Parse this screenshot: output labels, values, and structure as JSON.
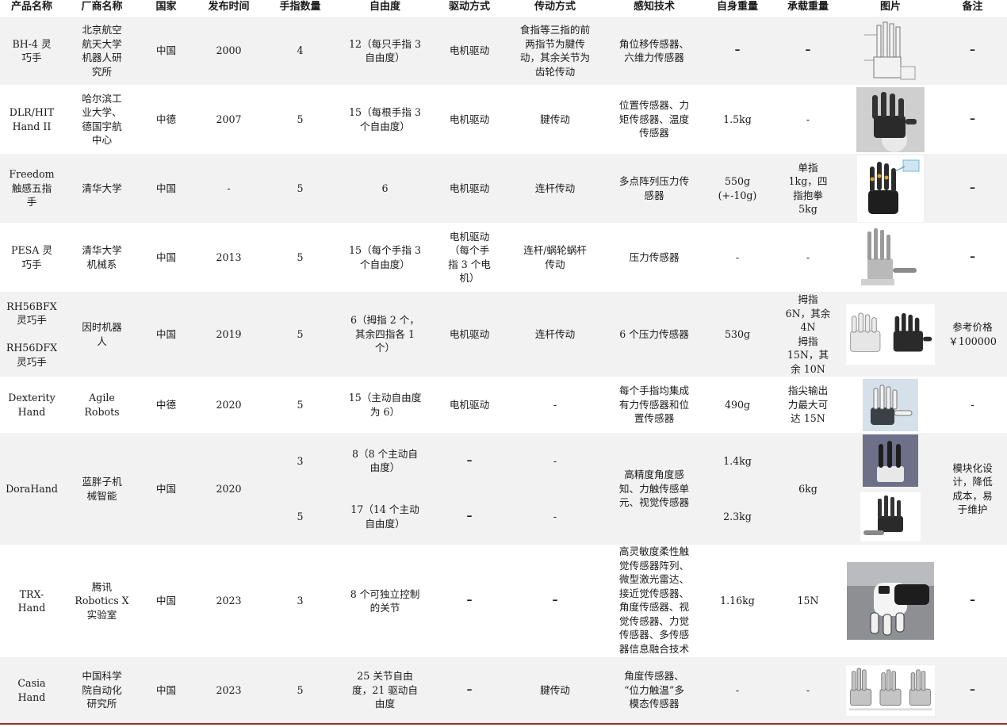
{
  "headers": [
    "产品名称",
    "厂商名称",
    "国家",
    "发布时间",
    "手指数量",
    "自由度",
    "驱动方式",
    "传动方式",
    "感知技术",
    "自身重量",
    "承载重量",
    "图片",
    "备注"
  ],
  "rows": [
    {
      "product": "BH-4 灵\n巧手",
      "maker": "北京航空\n航天大学\n机器人研\n究所",
      "country": "中国",
      "year": "2000",
      "fingers": "4",
      "dof": "12（每只手指 3\n自由度）",
      "drive": "电机驱动",
      "trans": "食指等三指的前\n两指节为腱传\n动，其余关节为\n齿轮传动",
      "sense": "角位移传感器、\n六维力传感器",
      "weight": "–",
      "load": "–",
      "image": "drawing-icon",
      "note": "–"
    },
    {
      "product": "DLR/HIT\nHand II",
      "maker": "哈尔滨工\n业大学、\n德国宇航\n中心",
      "country": "中德",
      "year": "2007",
      "fingers": "5",
      "dof": "15（每根手指 3\n个自由度）",
      "drive": "电机驱动",
      "trans": "腱传动",
      "sense": "位置传感器、力\n矩传感器、温度\n传感器",
      "weight": "1.5kg",
      "load": "-",
      "image": "robot-hand-photo-icon",
      "note": "–"
    },
    {
      "product": "Freedom\n触感五指\n手",
      "maker": "清华大学",
      "country": "中国",
      "year": "-",
      "fingers": "5",
      "dof": "6",
      "drive": "电机驱动",
      "trans": "连杆传动",
      "sense": "多点阵列压力传\n感器",
      "weight": "550g\n(+-10g)",
      "load": "单指\n1kg，四\n指抱拳\n5kg",
      "image": "robot-hand-photo-icon",
      "note": "–"
    },
    {
      "product": "PESA 灵\n巧手",
      "maker": "清华大学\n机械系",
      "country": "中国",
      "year": "2013",
      "fingers": "5",
      "dof": "15（每个手指 3\n个自由度）",
      "drive": "电机驱动\n（每个手\n指 3 个电\n机）",
      "trans": "连杆/蜗轮蜗杆\n传动",
      "sense": "压力传感器",
      "weight": "-",
      "load": "-",
      "image": "robot-hand-photo-icon",
      "note": "–"
    },
    {
      "product": "RH56BFX\n灵巧手\n\nRH56DFX\n灵巧手",
      "maker": "因时机器\n人",
      "country": "中国",
      "year": "2019",
      "fingers": "5",
      "dof": "6（拇指 2 个，\n其余四指各 1\n个）",
      "drive": "电机驱动",
      "trans": "连杆传动",
      "sense": "6 个压力传感器",
      "weight": "530g",
      "load": "拇指\n6N，其余\n4N\n拇指\n15N，其\n余 10N",
      "image": "robot-hand-pair-photo-icon",
      "note": "参考价格\n￥100000"
    },
    {
      "product": "Dexterity\nHand",
      "maker": "Agile\nRobots",
      "country": "中德",
      "year": "2020",
      "fingers": "5",
      "dof": "15（主动自由度\n为 6）",
      "drive": "电机驱动",
      "trans": "-",
      "sense": "每个手指均集成\n有力传感器和位\n置传感器",
      "weight": "490g",
      "load": "指尖输出\n力最大可\n达 15N",
      "image": "robot-hand-photo-icon",
      "note": "-"
    },
    {
      "product": "DoraHand",
      "maker": "蓝胖子机\n械智能",
      "country": "中国",
      "year": "2020",
      "fingers_a": "3",
      "fingers_b": "5",
      "dof_a": "8（8 个主动自\n由度）",
      "dof_b": "17（14 个主动\n自由度）",
      "drive_a": "–",
      "drive_b": "–",
      "trans_a": "-",
      "trans_b": "-",
      "sense": "高精度角度感\n知、力触传感单\n元、视觉传感器",
      "weight_a": "1.4kg",
      "weight_b": "2.3kg",
      "load": "6kg",
      "image": "robot-hand-photo-icon",
      "note": "模块化设\n计，降低\n成本，易\n于维护"
    },
    {
      "product": "TRX-\nHand",
      "maker": "腾讯\nRobotics X\n实验室",
      "country": "中国",
      "year": "2023",
      "fingers": "3",
      "dof": "8 个可独立控制\n的关节",
      "drive": "–",
      "trans": "–",
      "sense": "高灵敏度柔性触\n觉传感器阵列、\n微型激光雷达、\n接近觉传感器、\n角度传感器、视\n觉传感器、力觉\n传感器、多传感\n器信息融合技术",
      "weight": "1.16kg",
      "load": "15N",
      "image": "robot-hand-photo-icon",
      "note": "–"
    },
    {
      "product": "Casia\nHand",
      "maker": "中国科学\n院自动化\n研究所",
      "country": "中国",
      "year": "2023",
      "fingers": "5",
      "dof": "25 关节自由\n度，21 驱动自\n由度",
      "drive": "–",
      "trans": "腱传动",
      "sense": "角度传感器、\n“位力触温”多\n模态传感器",
      "weight": "-",
      "load": "-",
      "image": "robot-hand-trio-photo-icon",
      "note": "–"
    }
  ]
}
